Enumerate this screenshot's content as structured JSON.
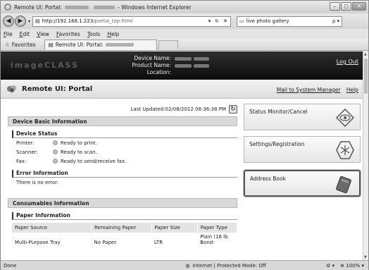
{
  "window": {
    "title_prefix": "Remote UI: Portal:",
    "title_suffix": "- Windows Internet Explorer",
    "min": "–",
    "max": "▢",
    "close": "✕"
  },
  "address": {
    "host": "http://192.168.1.223",
    "path": "/portal_top.html",
    "dropdown": "▾",
    "refresh": "↻",
    "stop": "✕",
    "search_text": "live photo gallery",
    "search_go": "ρ ▾"
  },
  "menu": [
    "File",
    "Edit",
    "View",
    "Favorites",
    "Tools",
    "Help"
  ],
  "favorites": {
    "label": "Favorites",
    "tab_label": "Remote UI: Portal:"
  },
  "header": {
    "logo": "imageCLASS",
    "device_name_label": "Device Name:",
    "product_name_label": "Product Name:",
    "location_label": "Location:",
    "logout": "Log Out"
  },
  "portal": {
    "title": "Remote UI: Portal",
    "mail_link": "Mail to System Manager",
    "help_link": "Help",
    "last_updated": "Last Updated:02/08/2012 08:36:38 PM"
  },
  "device_basic": {
    "heading": "Device Basic Information",
    "status_heading": "Device Status",
    "rows": [
      {
        "k": "Printer:",
        "v": "Ready to print."
      },
      {
        "k": "Scanner:",
        "v": "Ready to scan."
      },
      {
        "k": "Fax:",
        "v": "Ready to send/receive fax."
      }
    ],
    "error_heading": "Error Information",
    "error_text": "There is no error."
  },
  "consumables": {
    "heading": "Consumables Information",
    "paper_heading": "Paper Information",
    "columns": [
      "Paper Source",
      "Remaining Paper",
      "Paper Size",
      "Paper Type"
    ],
    "row": [
      "Multi-Purpose Tray",
      "No Paper",
      "LTR",
      "Plain (16 lb Bond-"
    ]
  },
  "side": {
    "status_monitor": "Status Monitor/Cancel",
    "settings": "Settings/Registration",
    "address_book": "Address Book"
  },
  "status": {
    "done": "Done",
    "zone": "Internet | Protected Mode: Off",
    "zoom": "100%"
  }
}
